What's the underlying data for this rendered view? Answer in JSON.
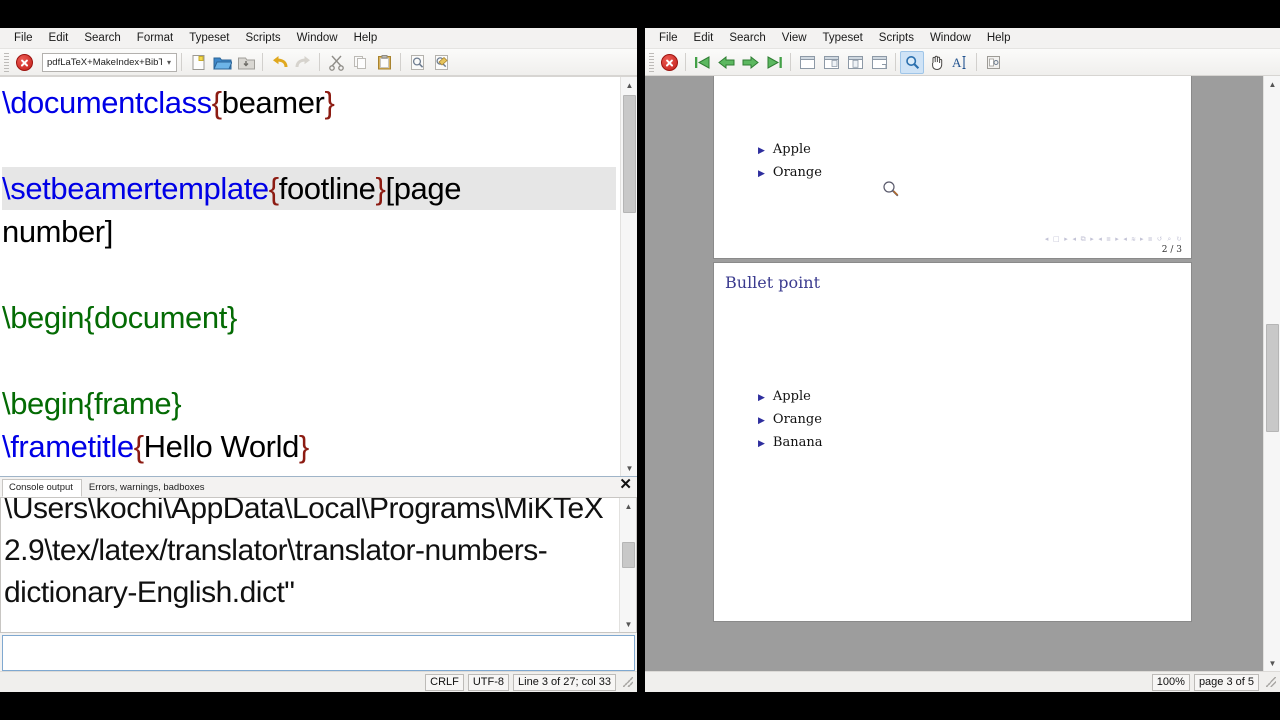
{
  "editor": {
    "menubar": [
      "File",
      "Edit",
      "Search",
      "Format",
      "Typeset",
      "Scripts",
      "Window",
      "Help"
    ],
    "toolbar": {
      "stop_label": "abort-typesetting",
      "typeset_engine": "pdfLaTeX+MakeIndex+BibTeX",
      "buttons": [
        "new-document-icon",
        "open-file-icon",
        "save-file-icon",
        "undo-icon",
        "redo-icon",
        "cut-icon",
        "copy-icon",
        "paste-icon",
        "find-icon",
        "find-replace-icon"
      ]
    },
    "code_lines": [
      {
        "highlight": false,
        "parts": [
          {
            "cls": "cmd",
            "t": "\\documentclass"
          },
          {
            "cls": "brc",
            "t": "{"
          },
          {
            "cls": "txt",
            "t": "beamer"
          },
          {
            "cls": "brc",
            "t": "}"
          }
        ]
      },
      {
        "highlight": false,
        "parts": []
      },
      {
        "highlight": true,
        "parts": [
          {
            "cls": "cmd",
            "t": "\\setbeamertemplate"
          },
          {
            "cls": "brc",
            "t": "{"
          },
          {
            "cls": "txt",
            "t": "footline"
          },
          {
            "cls": "brc",
            "t": "}"
          },
          {
            "cls": "txt",
            "t": "[page"
          }
        ]
      },
      {
        "highlight": false,
        "parts": [
          {
            "cls": "txt",
            "t": "number]"
          }
        ]
      },
      {
        "highlight": false,
        "parts": []
      },
      {
        "highlight": false,
        "parts": [
          {
            "cls": "env",
            "t": "\\begin{document}"
          }
        ]
      },
      {
        "highlight": false,
        "parts": []
      },
      {
        "highlight": false,
        "parts": [
          {
            "cls": "env",
            "t": "\\begin{frame}"
          }
        ]
      },
      {
        "highlight": false,
        "parts": [
          {
            "cls": "cmd",
            "t": "\\frametitle"
          },
          {
            "cls": "brc",
            "t": "{"
          },
          {
            "cls": "txt",
            "t": "Hello World"
          },
          {
            "cls": "brc",
            "t": "}"
          }
        ]
      }
    ],
    "console": {
      "tabs": [
        {
          "label": "Console output",
          "selected": true
        },
        {
          "label": "Errors, warnings, badboxes",
          "selected": false
        }
      ],
      "close_label": "✕",
      "output": "\\Users\\kochi\\AppData\\Local\\Programs\\MiKTeX 2.9\\tex/latex/translator\\translator-numbers-dictionary-English.dict\"",
      "input_value": "",
      "input_placeholder": ""
    },
    "statusbar": {
      "line_ending": "CRLF",
      "encoding": "UTF-8",
      "cursor": "Line 3 of 27; col 33"
    }
  },
  "viewer": {
    "menubar": [
      "File",
      "Edit",
      "Search",
      "View",
      "Typeset",
      "Scripts",
      "Window",
      "Help"
    ],
    "toolbar": {
      "stop_label": "abort-typesetting",
      "buttons": [
        "first-page-icon",
        "previous-page-icon",
        "next-page-icon",
        "last-page-icon",
        "fit-window-icon",
        "fit-width-icon",
        "fit-page-icon",
        "actual-size-icon",
        "magnify-icon",
        "hand-scroll-icon",
        "select-text-icon",
        "full-screen-icon"
      ],
      "active_tool": "magnify-icon"
    },
    "pages": [
      {
        "title": "",
        "bullets": [
          "Apple",
          "Orange"
        ],
        "nav_symbols": "◂ □ ▸  ◂ ⧉ ▸  ◂ ≣ ▸  ◂ ≋ ▸   ≣   ↺ ⌕ ↻",
        "page_label": "2 / 3",
        "magnifier_icon": "magnify-icon"
      },
      {
        "title": "Bullet point",
        "bullets": [
          "Apple",
          "Orange",
          "Banana"
        ],
        "nav_symbols": "",
        "page_label": "",
        "magnifier_icon": ""
      }
    ],
    "statusbar": {
      "zoom": "100%",
      "page": "page 3 of 5"
    }
  },
  "colors": {
    "latex_command": "#0000e6",
    "latex_environment": "#046b04",
    "latex_brace": "#8c1b12",
    "beamer_title": "#3b3b8f",
    "beamer_bullet": "#2e2e9e",
    "highlight_line": "#e6e6e6",
    "toolbar_active": "#cfe3f6"
  }
}
